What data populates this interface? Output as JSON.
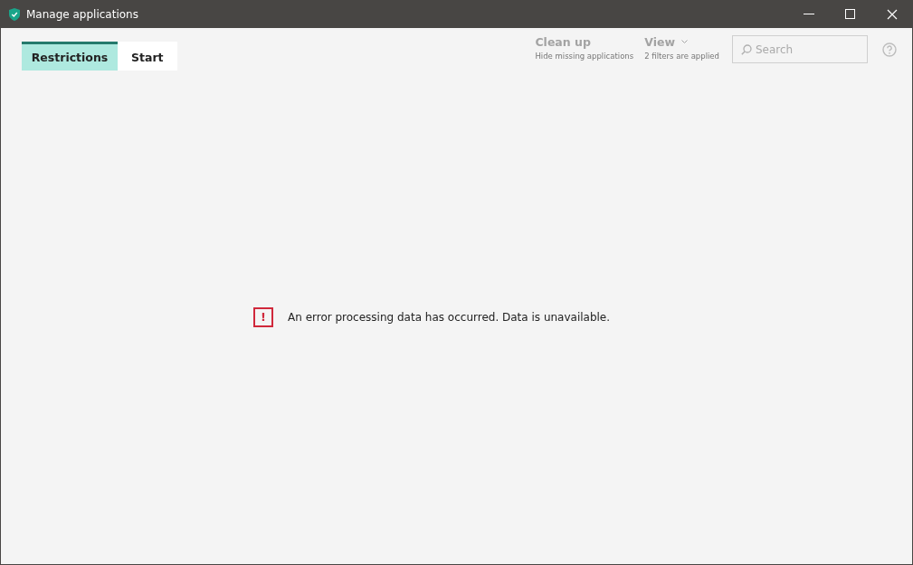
{
  "window": {
    "title": "Manage applications"
  },
  "tabs": [
    {
      "label": "Restrictions",
      "selected": true
    },
    {
      "label": "Start",
      "selected": false
    }
  ],
  "actions": [
    {
      "label": "Clean up",
      "caption": "Hide missing applications",
      "disabled": true,
      "dropdown": false
    },
    {
      "label": "View",
      "caption": "2 filters are applied",
      "disabled": true,
      "dropdown": true
    }
  ],
  "search": {
    "placeholder": "Search"
  },
  "error": {
    "mark": "!",
    "message": "An error processing data has occurred. Data is unavailable."
  }
}
